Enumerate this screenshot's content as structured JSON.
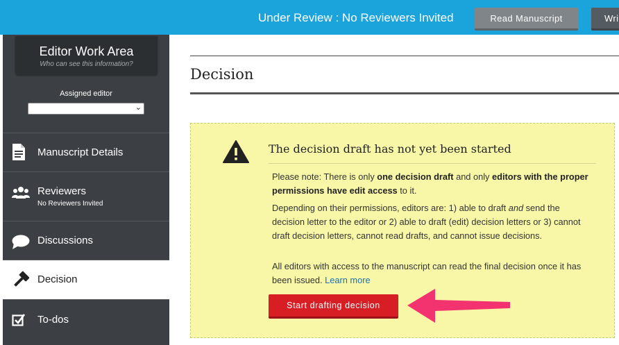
{
  "header": {
    "status": "Under Review : No Reviewers Invited",
    "read_button": "Read Manuscript",
    "write_button": "Wri"
  },
  "sidebar": {
    "work_area_title": "Editor Work Area",
    "work_area_subtitle": "Who can see this information?",
    "assigned_editor_label": "Assigned editor",
    "assigned_editor_value": "",
    "items": [
      {
        "label": "Manuscript Details",
        "icon": "document-icon"
      },
      {
        "label": "Reviewers",
        "sub": "No Reviewers Invited",
        "icon": "people-icon"
      },
      {
        "label": "Discussions",
        "icon": "chat-bubble-icon"
      },
      {
        "label": "Decision",
        "icon": "gavel-icon",
        "active": true
      },
      {
        "label": "To-dos",
        "icon": "checkbox-icon"
      }
    ]
  },
  "main": {
    "title": "Decision",
    "notice": {
      "title": "The decision draft has not yet been started",
      "p1_a": "Please note: There is only ",
      "p1_b": "one decision draft",
      "p1_c": " and only ",
      "p1_d": "editors with the proper permissions have edit access",
      "p1_e": " to it.",
      "p2_a": "Depending on their permissions, editors are: 1) able to draft ",
      "p2_b": "and",
      "p2_c": " send the decision letter to the editor or 2) able to draft (edit) decision letters or 3) cannot draft decision letters, cannot read drafts, and cannot issue decisions.",
      "p3_a": "All editors with access to the manuscript can read the final decision once it has been issued. ",
      "p3_link": "Learn more",
      "button": "Start drafting decision"
    }
  },
  "colors": {
    "topbar": "#1ba3dc",
    "sidebar": "#3c4044",
    "notice_bg": "#f8f7a8",
    "start_button": "#d81e25",
    "arrow": "#f2336f"
  }
}
